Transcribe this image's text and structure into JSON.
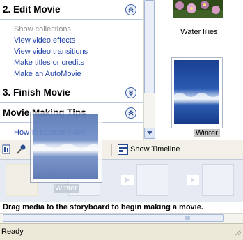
{
  "task_pane": {
    "edit_movie": {
      "title": "2. Edit Movie",
      "links": [
        "Show collections",
        "View video effects",
        "View video transitions",
        "Make titles or credits",
        "Make an AutoMovie"
      ]
    },
    "finish_movie": {
      "title": "3. Finish Movie"
    },
    "tips": {
      "title": "Movie Making Tips",
      "links": [
        "How to capture video"
      ]
    }
  },
  "collection": {
    "items": [
      {
        "label": "Water lilies",
        "icon": "water-lilies-thumbnail"
      },
      {
        "label": "Winter",
        "icon": "winter-thumbnail",
        "selected": true
      }
    ]
  },
  "toolbar": {
    "show_timeline_label": "Show Timeline"
  },
  "storyboard": {
    "hint": "Drag media to the storyboard to begin making a movie.",
    "drag_label": "Winter"
  },
  "status": {
    "text": "Ready"
  },
  "colors": {
    "link": "#2345a8",
    "link_disabled": "#8e8e8e",
    "storyboard_bg": "#e6ebf3",
    "toolbar_bg": "#f2f0e8"
  }
}
